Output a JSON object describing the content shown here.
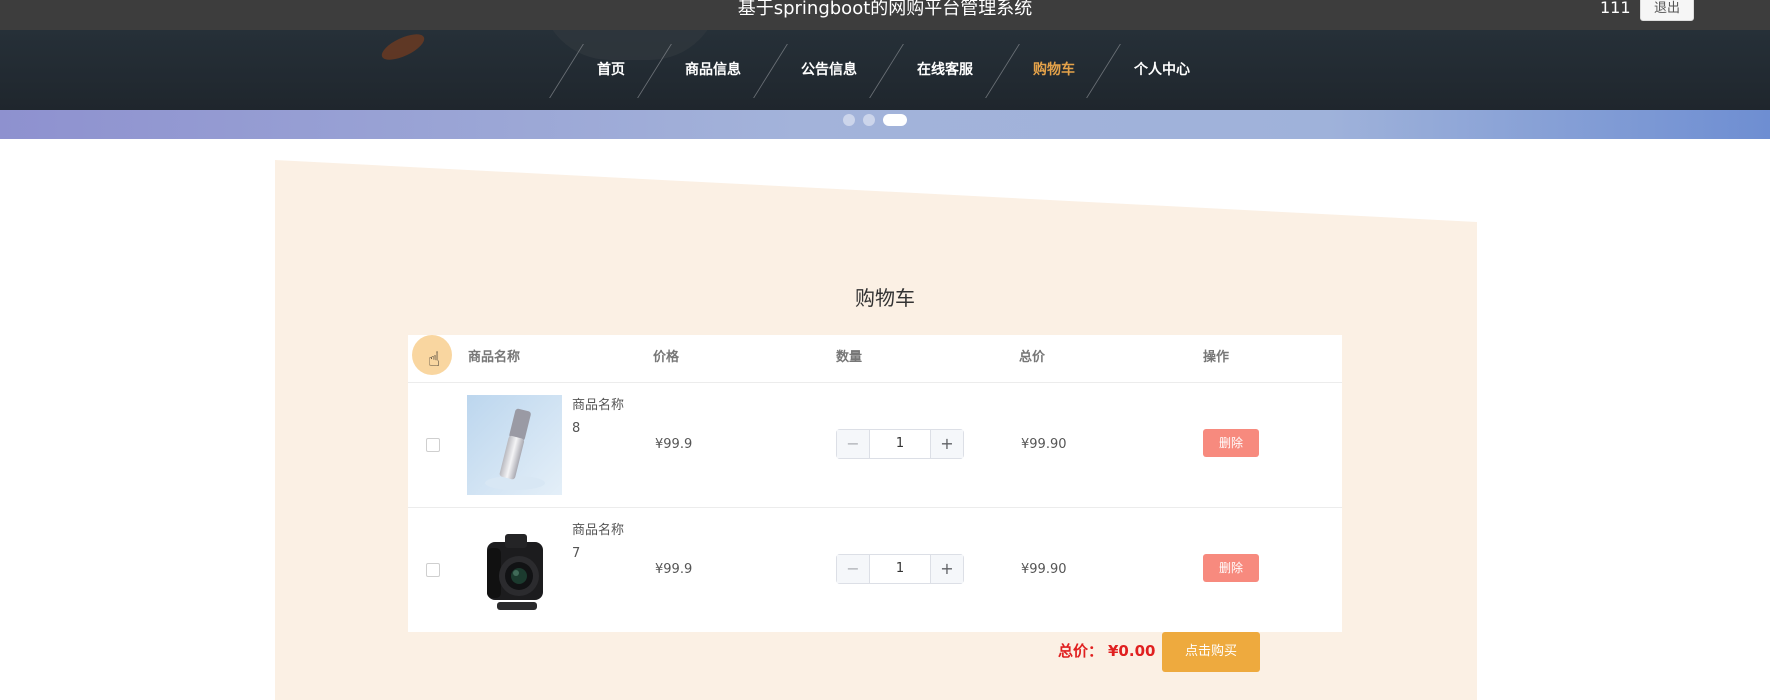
{
  "header": {
    "site_title": "基于springboot的网购平台管理系统",
    "username": "111",
    "logout_label": "退出"
  },
  "nav": {
    "items": [
      {
        "label": "首页",
        "active": false
      },
      {
        "label": "商品信息",
        "active": false
      },
      {
        "label": "公告信息",
        "active": false
      },
      {
        "label": "在线客服",
        "active": false
      },
      {
        "label": "购物车",
        "active": true
      },
      {
        "label": "个人中心",
        "active": false
      }
    ],
    "active_color": "#e4a24a"
  },
  "banner": {
    "slide_count": 3,
    "active_slide": 3
  },
  "cart": {
    "title": "购物车",
    "columns": [
      "商品名称",
      "价格",
      "数量",
      "总价",
      "操作"
    ],
    "items": [
      {
        "name_line1": "商品名称",
        "name_line2": "8",
        "image_icon": "skincare-bottle-image",
        "price": "¥99.9",
        "quantity": "1",
        "subtotal": "¥99.90",
        "delete_label": "删除",
        "checked": false
      },
      {
        "name_line1": "商品名称",
        "name_line2": "7",
        "image_icon": "camera-image",
        "price": "¥99.9",
        "quantity": "1",
        "subtotal": "¥99.90",
        "delete_label": "删除",
        "checked": false
      }
    ],
    "stepper": {
      "minus": "−",
      "plus": "+"
    },
    "total_label": "总价：",
    "total_value": "¥0.00",
    "buy_label": "点击购买"
  },
  "colors": {
    "total": "#e02020",
    "buy_button": "#eeaa3e",
    "delete_button": "#f78a7e",
    "panel_bg": "#fbf0e4"
  }
}
